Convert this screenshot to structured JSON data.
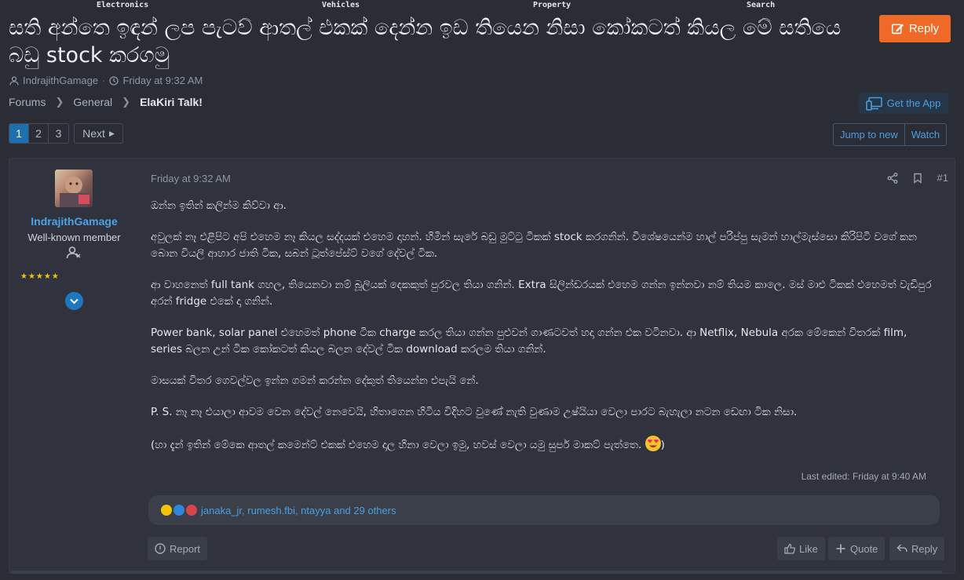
{
  "topnav": [
    "Electronics",
    "Vehicles",
    "Property",
    "Search"
  ],
  "thread": {
    "title": "සති අන්තෙ ඉඳන් ලප පැටව් ආතල් එකක් දෙන්න ඉඩ තියෙන නිසා කෝකටත් කියල මේ සතියෙ බඩු stock කරගමු",
    "author": "IndrajithGamage",
    "date": "Friday at 9:32 AM",
    "reply_label": "Reply"
  },
  "breadcrumb": [
    "Forums",
    "General",
    "ElaKiri Talk!"
  ],
  "get_app": "Get the App",
  "pagination": {
    "pages": [
      "1",
      "2",
      "3"
    ],
    "current": "1",
    "next": "Next"
  },
  "jump_new": "Jump to new",
  "watch": "Watch",
  "post": {
    "user": {
      "name": "IndrajithGamage",
      "title": "Well-known member",
      "stars": "★★★★★"
    },
    "date": "Friday at 9:32 AM",
    "number": "#1",
    "paragraphs": [
      "ඔන්න ඉතින් කලින්ම කිව්වා ආ.",
      "අවුලක් නෑ එළිපිට අපි එහෙම නෑ කියල සද්දයක් එහෙම දාහන්. හිමින් සැරේ බඩු මුට්ටු ටිකක් stock කරගනින්. විශේෂයෙන්ම හාල් පරිප්පු සැමන් හාල්මැස්සො කිරිපිටි වගේ කන බොන වියලි ආහාර ජාති ටික, සබන් ටූත්පේස්ට් වගේ දේවල් ටික.",
      "ආ වාහනෙත් full tank ගහල, තියෙනවා නම් බූලියක් දෙකකුත් පුරවල තියා ගනින්. Extra සිලින්ඩරයක් එහෙම ගන්න ඉන්නවා නම් තියම කාලෙ. මස් මාළු ටිකක් එහෙමත් වැඩිපුර අරන් fridge එකේ දා ගනින්.",
      "Power bank, solar panel එහෙමත් phone ටික charge කරල තියා ගන්න පුළුවන් ගාණටවත් හදා ගන්න එක වටිනවා. ආ Netflix, Nebula අරක මේකෙන් විතරක් film, series බලන උන් ටික කෝකටත් කියල බලන දේවල් ටික download කරලම තියා ගනින්.",
      "මාසයක් විතර ගෙවල්වල ඉන්න ගමන් කරන්න දේකුත් තියෙන්න එපැයි නේ.",
      "P. S. නෑ නෑ එයාලා ආවම වෙන දේවල් නෙවෙයි, හිතාගෙන හිටිය විදිහට වුණේ නැති වුණාම උෂ්යියා වෙලා පාරට බැහැලා නටන ඩෙඟා ටික නිසා.",
      "(හා දැන් ඉතින් මේකෙ ආතල් කමෙන්ට් එකක් එහෙම දාල හිනා වෙලා ඉමු, හවස් වෙලා යමු සුපර් මාකට් පැත්තෙ."
    ],
    "closing_paren": ")",
    "last_edited": "Last edited: Friday at 9:40 AM",
    "reactions_text": "janaka_jr, rumesh.fbi, ntayya and 29 others",
    "buttons": {
      "report": "Report",
      "like": "Like",
      "quote": "Quote",
      "reply": "Reply"
    }
  },
  "colors": {
    "accent": "#ef6a26",
    "link": "#4a9fe0",
    "active_page": "#1d6fb0",
    "background": "#2a2d36"
  }
}
